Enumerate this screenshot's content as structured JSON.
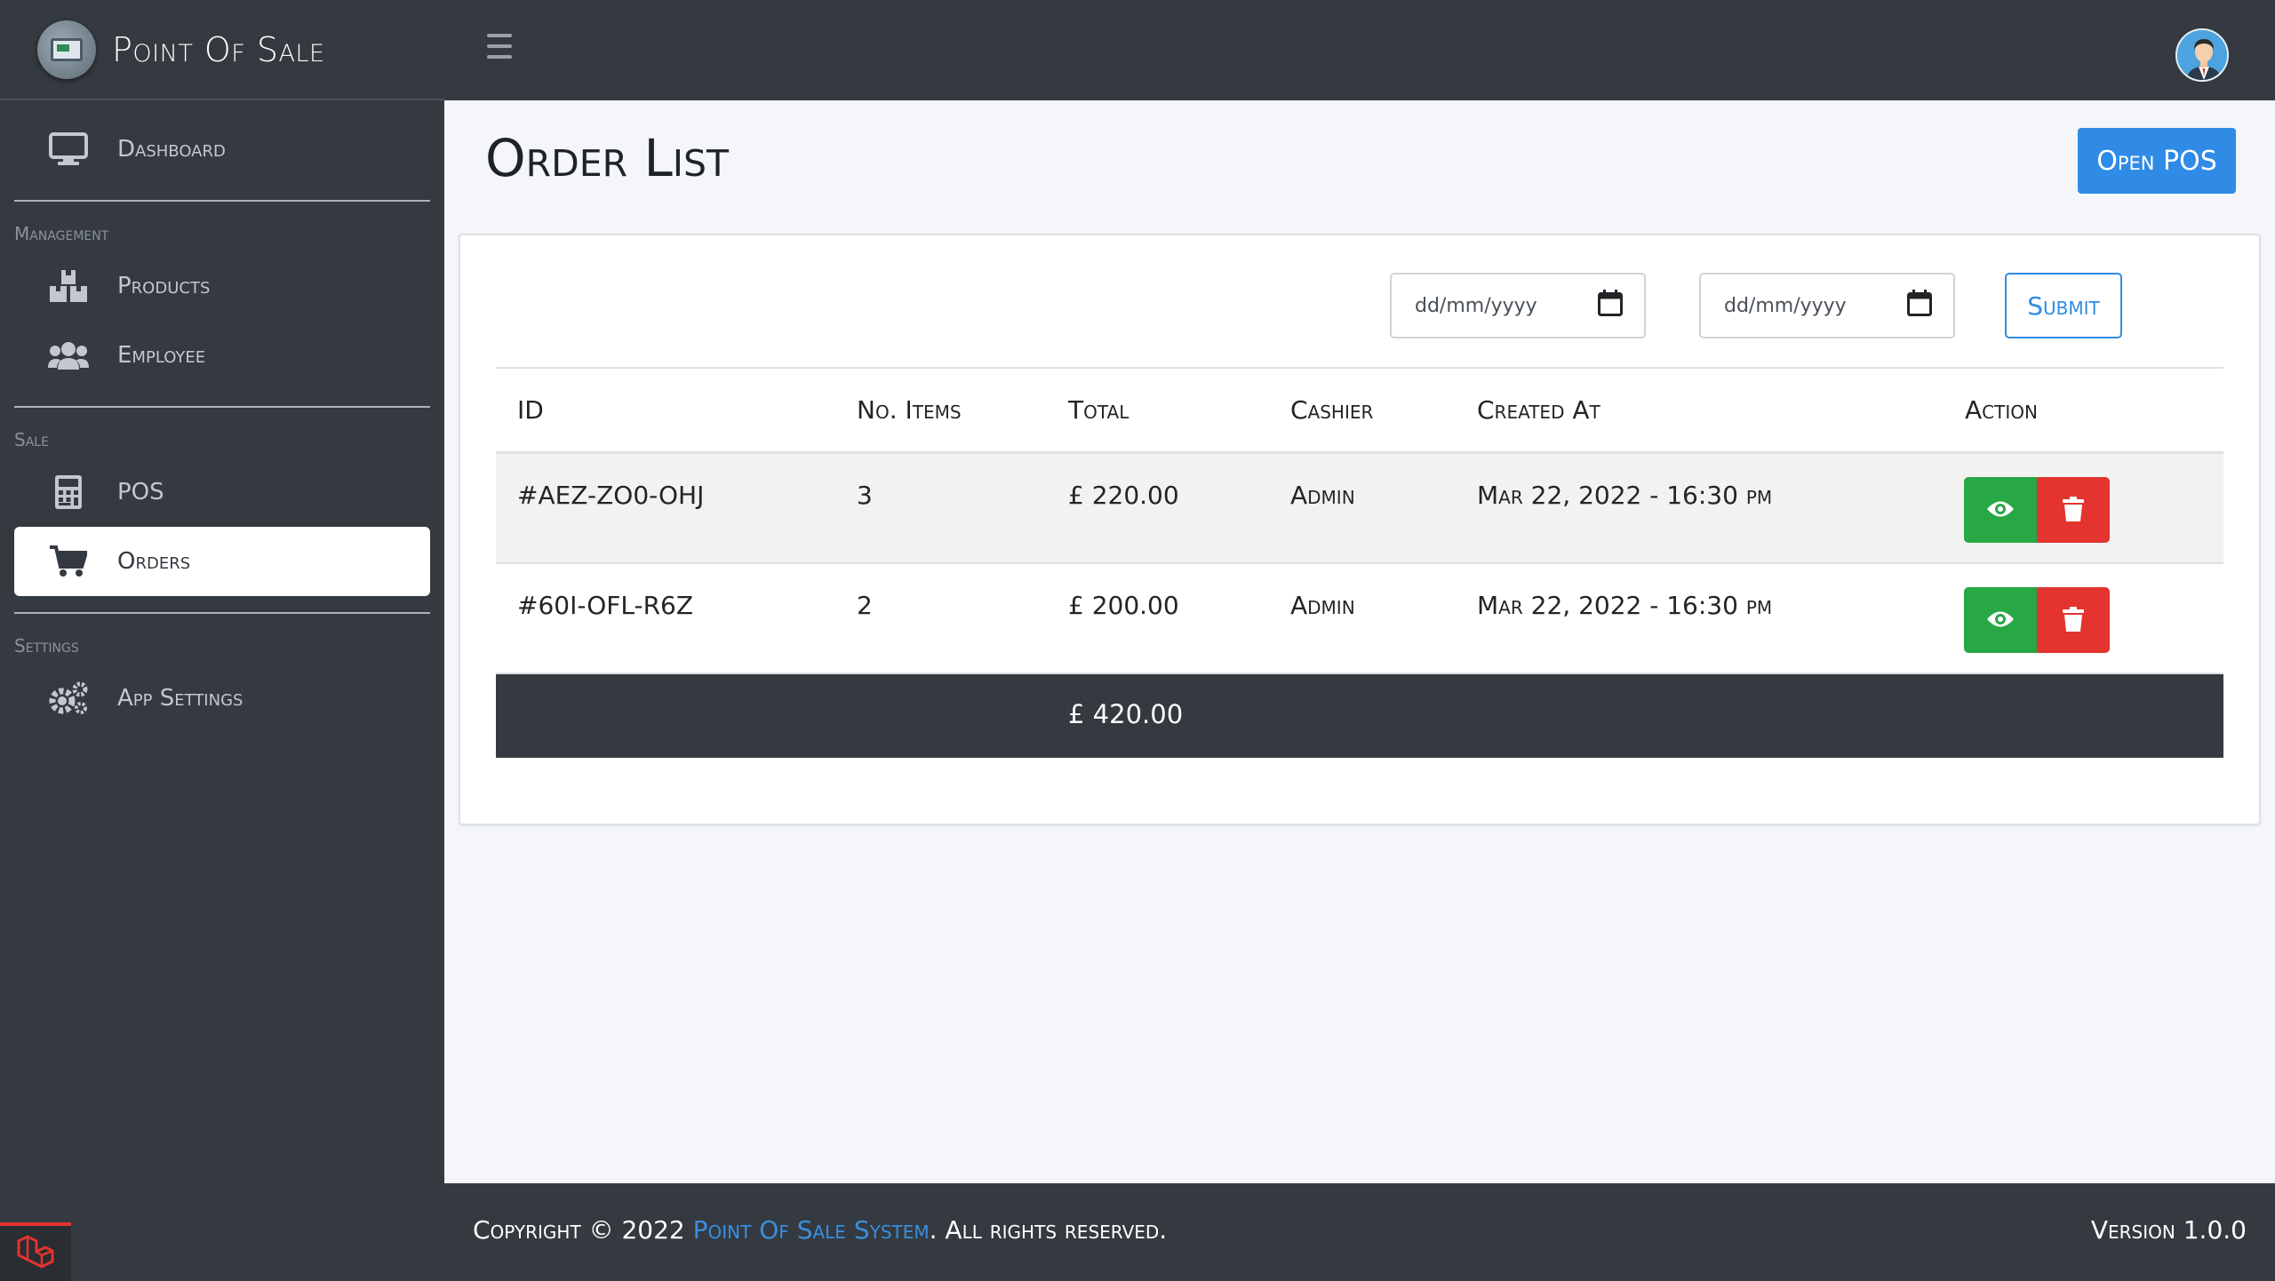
{
  "brand": {
    "name": "Point Of Sale"
  },
  "sidebar": {
    "dashboard": {
      "label": "Dashboard",
      "icon": "monitor-icon"
    },
    "sections": [
      {
        "header": "Management",
        "items": [
          {
            "label": "Products",
            "icon": "boxes-icon"
          },
          {
            "label": "Employee",
            "icon": "users-icon"
          }
        ]
      },
      {
        "header": "Sale",
        "items": [
          {
            "label": "POS",
            "icon": "calculator-icon"
          },
          {
            "label": "Orders",
            "icon": "cart-icon",
            "active": true
          }
        ]
      },
      {
        "header": "Settings",
        "items": [
          {
            "label": "App Settings",
            "icon": "gears-icon"
          }
        ]
      }
    ]
  },
  "page": {
    "title": "Order List",
    "open_pos_label": "Open POS"
  },
  "filters": {
    "start_date_placeholder": "dd/mm/yyyy",
    "end_date_placeholder": "dd/mm/yyyy",
    "submit_label": "Submit"
  },
  "table": {
    "headers": [
      "ID",
      "No. Items",
      "Total",
      "Cashier",
      "Created At",
      "Action"
    ],
    "rows": [
      {
        "id": "#AEZ-ZO0-OHJ",
        "items": "3",
        "total": "£ 220.00",
        "cashier": "Admin",
        "created": "Mar 22, 2022 - 16:30 pm"
      },
      {
        "id": "#60I-OFL-R6Z",
        "items": "2",
        "total": "£ 200.00",
        "cashier": "Admin",
        "created": "Mar 22, 2022 - 16:30 pm"
      }
    ],
    "grand_total": "£ 420.00"
  },
  "footer": {
    "copyright_prefix": "Copyright © 2022 ",
    "link_text": "Point Of Sale System",
    "copyright_suffix": ". All rights reserved.",
    "version": "Version 1.0.0"
  },
  "colors": {
    "sidebar_bg": "#343a40",
    "primary": "#2f8be6",
    "success": "#28a745",
    "danger": "#e3342f"
  }
}
